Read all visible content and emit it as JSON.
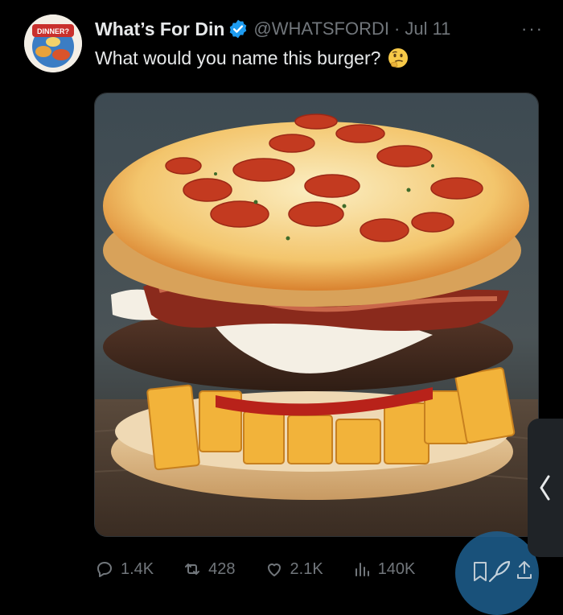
{
  "tweet": {
    "display_name": "What’s For Din",
    "handle": "@WHATSFORDI",
    "separator": "·",
    "date": "Jul 11",
    "more": "···",
    "text": "What would you name this burger?",
    "emoji": "thinking-face-emoji",
    "avatar_text": "DINNER?"
  },
  "actions": {
    "replies": "1.4K",
    "reposts": "428",
    "likes": "2.1K",
    "views": "140K"
  },
  "colors": {
    "background": "#000000",
    "text": "#e7e9ea",
    "muted": "#71767b",
    "verified": "#1d9bf0"
  }
}
